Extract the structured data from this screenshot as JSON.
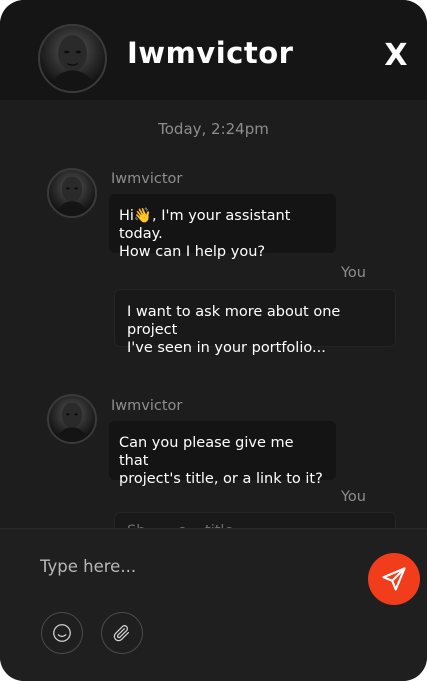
{
  "header": {
    "title": "Iwmvictor",
    "close_label": "X"
  },
  "conversation": {
    "timestamp": "Today, 2:24pm",
    "messages": [
      {
        "from": "Iwmvictor",
        "text": "Hi👋, I'm your assistant today.\nHow can I help you?"
      },
      {
        "from": "You",
        "text": "I want to ask more about one project\nI've seen in your portfolio..."
      },
      {
        "from": "Iwmvictor",
        "text": "Can you please give me that\nproject's title, or a link to it?"
      },
      {
        "from": "You",
        "text": "Sh... ...e ...title"
      }
    ]
  },
  "composer": {
    "placeholder": "Type here..."
  },
  "colors": {
    "background": "#1d1d1d",
    "header": "#151515",
    "send_button": "#f23d1d",
    "muted_text": "#8e8e8e"
  },
  "icons": [
    "avatar",
    "close-icon",
    "send-icon",
    "emoji-icon",
    "attachment-icon"
  ]
}
